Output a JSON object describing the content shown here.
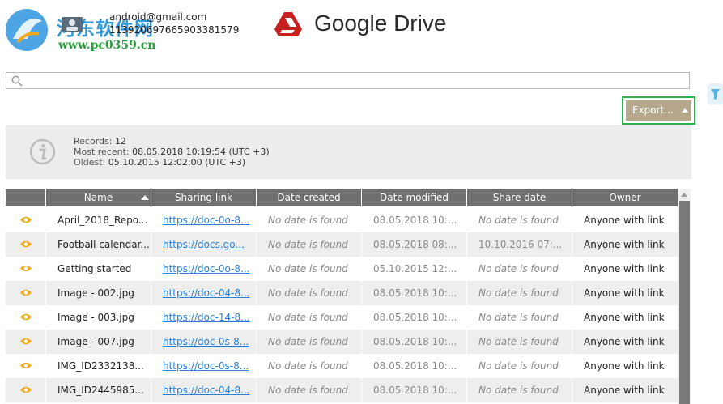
{
  "watermark": {
    "name_cn": "河东软件网",
    "url": "www.pc0359.cn"
  },
  "account": {
    "email": "android@gmail.com",
    "id": "113920697665903381579"
  },
  "app": {
    "title": "Google Drive",
    "brand_color": "#c8201e"
  },
  "search": {
    "value": "",
    "placeholder": ""
  },
  "toolbar": {
    "export_label": "Export..."
  },
  "summary": {
    "records_label": "Records:",
    "records_value": "12",
    "recent_label": "Most recent:",
    "recent_value": "08.05.2018 10:19:54 (UTC +3)",
    "oldest_label": "Oldest:",
    "oldest_value": "05.10.2015 12:02:00 (UTC +3)"
  },
  "table": {
    "columns": [
      "Name",
      "Sharing link",
      "Date created",
      "Date modified",
      "Share date",
      "Owner"
    ],
    "sorted_column": "Name",
    "rows": [
      {
        "name": "April_2018_Repo...",
        "link": "https://doc-0o-8...",
        "created": "No date is found",
        "modified": "08.05.2018 10:...",
        "share": "No date is found",
        "owner": "Anyone with link"
      },
      {
        "name": "Football calendar...",
        "link": "https://docs.go...",
        "created": "No date is found",
        "modified": "08.05.2018 08:...",
        "share": "10.10.2016 07:...",
        "owner": "Anyone with link"
      },
      {
        "name": "Getting started",
        "link": "https://doc-0o-8...",
        "created": "No date is found",
        "modified": "05.10.2015 12:...",
        "share": "No date is found",
        "owner": "Anyone with link"
      },
      {
        "name": "Image - 002.jpg",
        "link": "https://doc-04-8...",
        "created": "No date is found",
        "modified": "08.05.2018 10:...",
        "share": "No date is found",
        "owner": "Anyone with link"
      },
      {
        "name": "Image - 003.jpg",
        "link": "https://doc-14-8...",
        "created": "No date is found",
        "modified": "08.05.2018 10:...",
        "share": "No date is found",
        "owner": "Anyone with link"
      },
      {
        "name": "Image - 007.jpg",
        "link": "https://doc-0s-8...",
        "created": "No date is found",
        "modified": "08.05.2018 10:...",
        "share": "No date is found",
        "owner": "Anyone with link"
      },
      {
        "name": "IMG_ID2332138...",
        "link": "https://doc-0s-8...",
        "created": "No date is found",
        "modified": "08.05.2018 10:...",
        "share": "No date is found",
        "owner": "Anyone with link"
      },
      {
        "name": "IMG_ID2445985...",
        "link": "https://doc-04-8...",
        "created": "No date is found",
        "modified": "08.05.2018 10:...",
        "share": "No date is found",
        "owner": "Anyone with link"
      }
    ]
  },
  "colors": {
    "accent_green": "#2bb24c",
    "export_button": "#b7a88d",
    "eye_icon": "#f0a81c",
    "link": "#2a7fd4"
  },
  "icons": [
    "watermark-logo-icon",
    "account-icon",
    "google-drive-logo-icon",
    "search-icon",
    "filter-icon",
    "info-icon",
    "eye-icon",
    "sort-ascending-icon"
  ]
}
